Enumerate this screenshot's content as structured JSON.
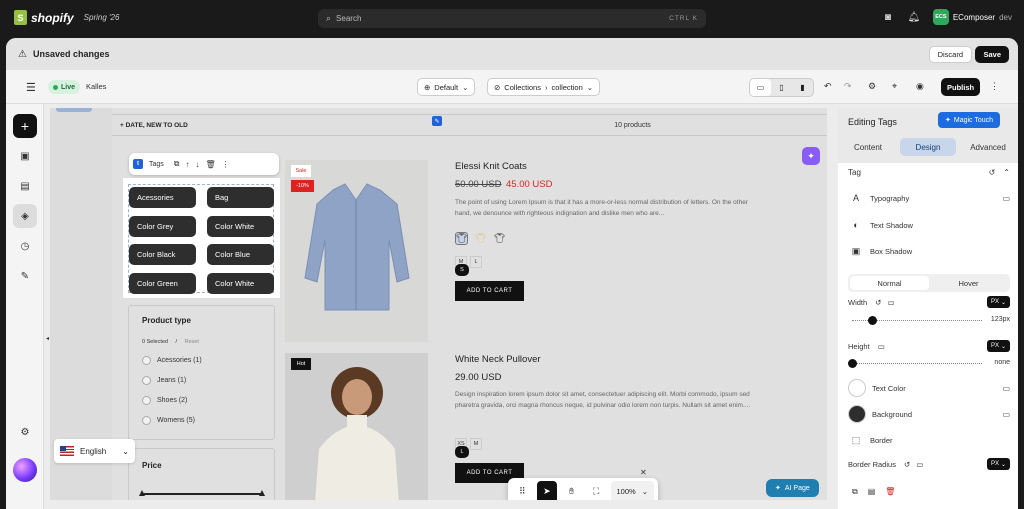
{
  "topbar": {
    "brand": "shopify",
    "edition": "Spring '26",
    "search_placeholder": "Search",
    "shortcut": "CTRL  K",
    "store_initials": "ECS",
    "store_name": "EComposer",
    "store_suffix": "dev"
  },
  "unsaved": {
    "title": "Unsaved changes",
    "discard": "Discard",
    "save": "Save"
  },
  "toolbar": {
    "live": "Live",
    "theme": "Kalles",
    "device_select": "Default",
    "template_prefix": "Collections",
    "template": "collection",
    "publish": "Publish"
  },
  "canvas": {
    "sort_label": "+ DATE, NEW TO OLD",
    "product_count": "10 products",
    "tag_widget_label": "Tags",
    "tags": [
      "Acessories",
      "Bag",
      "Color Grey",
      "Color White",
      "Color Black",
      "Color Blue",
      "Color Green",
      "Color White"
    ],
    "product_type": {
      "title": "Product type",
      "selected": "0 Selected",
      "separator": "/",
      "reset": "Reset",
      "options": [
        "Acessories (1)",
        "Jeans (1)",
        "Shoes (2)",
        "Womens (5)"
      ]
    },
    "price_title": "Price",
    "products": [
      {
        "title": "Elessi Knit Coats",
        "badge": "Sale",
        "discount": "-10%",
        "old_price": "50.00 USD",
        "price": "45.00 USD",
        "description": "The point of using Lorem Ipsum is that it has a more-or-less normal distribution of letters. On the other hand, we denounce with righteous indignation and dislike men who are...",
        "sizes": [
          "S",
          "M",
          "L"
        ],
        "cta": "ADD TO CART"
      },
      {
        "title": "White Neck Pullover",
        "badge": "Hot",
        "price": "29.00 USD",
        "description": "Design inspiration lorem ipsum dolor sit amet, consectetuer adipiscing elit. Morbi commodo, ipsum sed pharetra gravida, orci magna rhoncus neque, id pulvinar odio lorem non turpis. Nullam sit amet enim....",
        "sizes": [
          "L",
          "XS",
          "M"
        ],
        "cta": "ADD TO CART"
      }
    ],
    "zoom": "100%",
    "ai_page": "AI Page",
    "language": "English"
  },
  "panel": {
    "title": "Editing Tags",
    "magic_touch": "Magic Touch",
    "tabs": [
      "Content",
      "Design",
      "Advanced"
    ],
    "section": "Tag",
    "rows": {
      "typography": "Typography",
      "text_shadow": "Text Shadow",
      "box_shadow": "Box Shadow"
    },
    "states": [
      "Normal",
      "Hover"
    ],
    "width_label": "Width",
    "width_unit": "PX",
    "width_value": "123px",
    "height_label": "Height",
    "height_unit": "PX",
    "height_value": "none",
    "text_color_label": "Text Color",
    "background_label": "Background",
    "border_label": "Border",
    "border_radius_label": "Border Radius",
    "border_radius_unit": "PX"
  },
  "colors": {
    "live_green": "#2fa85b",
    "sale_red": "#dd2222",
    "accent_blue": "#1c6be0",
    "tag_bg": "#2e2e2e"
  }
}
